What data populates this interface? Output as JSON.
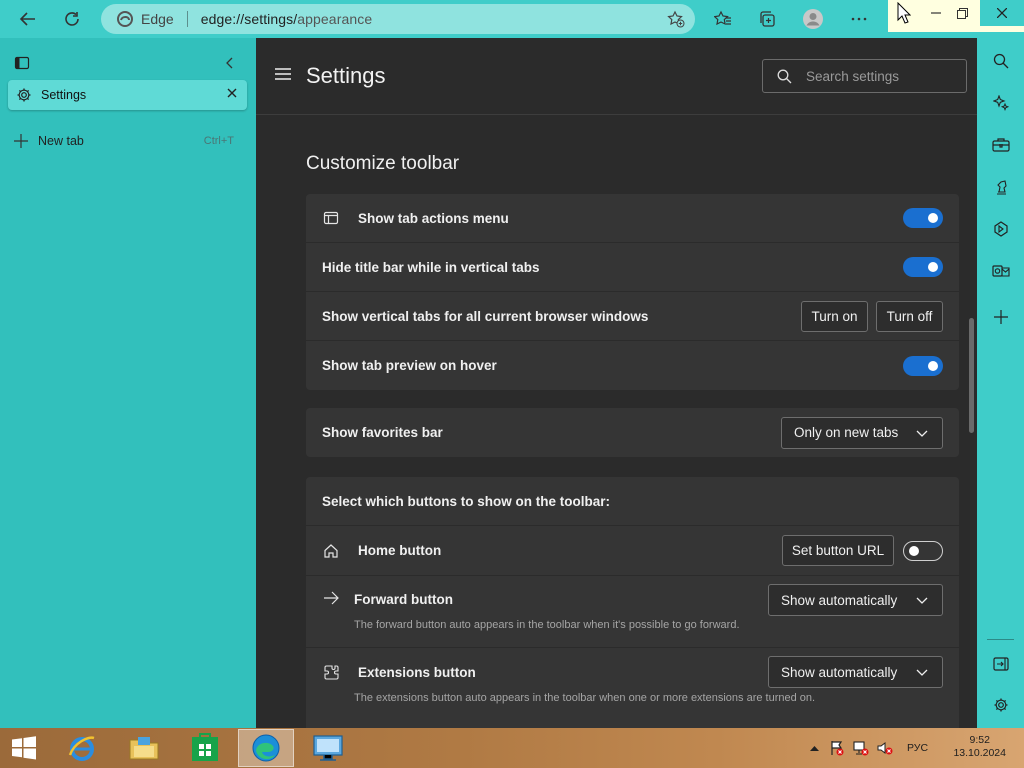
{
  "browser": {
    "site_label": "Edge",
    "url_host": "edge://settings/",
    "url_path": "appearance",
    "colors": {
      "accent": "#3fcdc9",
      "toggle_on": "#1a6fd0"
    }
  },
  "vertical_tabs": {
    "tabs": [
      {
        "label": "Settings",
        "icon": "gear-icon"
      }
    ],
    "new_tab": {
      "label": "New tab",
      "shortcut": "Ctrl+T"
    }
  },
  "settings": {
    "title": "Settings",
    "search_placeholder": "Search settings",
    "section_title": "Customize toolbar",
    "vertical_tabs_card": {
      "show_tab_actions": {
        "label": "Show tab actions menu",
        "enabled": true
      },
      "hide_title_bar": {
        "label": "Hide title bar while in vertical tabs",
        "enabled": true
      },
      "vertical_tabs_all": {
        "label": "Show vertical tabs for all current browser windows",
        "turn_on": "Turn on",
        "turn_off": "Turn off"
      },
      "tab_preview": {
        "label": "Show tab preview on hover",
        "enabled": true
      }
    },
    "favorites_bar": {
      "label": "Show favorites bar",
      "value": "Only on new tabs"
    },
    "toolbar_buttons": {
      "heading": "Select which buttons to show on the toolbar:",
      "home": {
        "label": "Home button",
        "set_url": "Set button URL",
        "enabled": false
      },
      "forward": {
        "label": "Forward button",
        "value": "Show automatically",
        "desc": "The forward button auto appears in the toolbar when it's possible to go forward."
      },
      "extensions": {
        "label": "Extensions button",
        "value": "Show automatically",
        "desc": "The extensions button auto appears in the toolbar when one or more extensions are turned on."
      }
    }
  },
  "taskbar": {
    "lang": "РУС",
    "time": "9:52",
    "date": "13.10.2024"
  }
}
